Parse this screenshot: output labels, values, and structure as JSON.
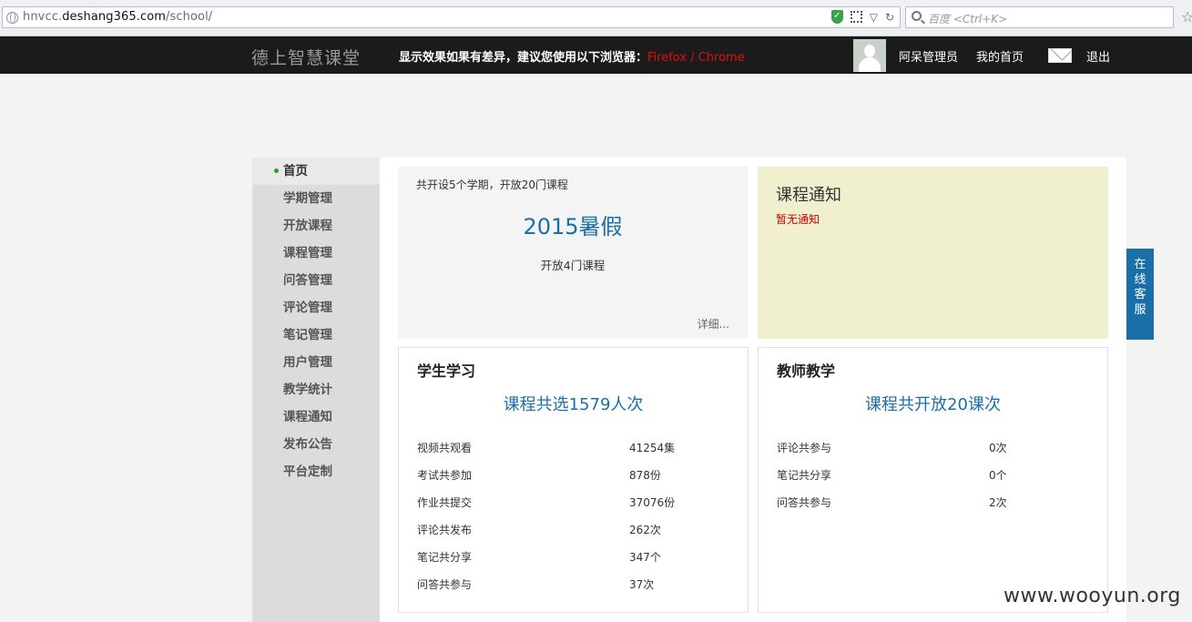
{
  "browser": {
    "url_prefix": "hnvcc.",
    "url_domain": "deshang365.com",
    "url_path": "/school/",
    "search_placeholder": "百度 <Ctrl+K>"
  },
  "header": {
    "logo": "德上智慧课堂",
    "notice_text": "显示效果如果有差异，建议您使用以下浏览器：",
    "browser_firefox": "Firefox",
    "browser_sep": " / ",
    "browser_chrome": "Chrome",
    "username": "阿呆管理员",
    "home_link": "我的首页",
    "logout": "退出"
  },
  "sidebar": {
    "items": [
      {
        "label": "首页",
        "active": true
      },
      {
        "label": "学期管理"
      },
      {
        "label": "开放课程"
      },
      {
        "label": "课程管理"
      },
      {
        "label": "问答管理"
      },
      {
        "label": "评论管理"
      },
      {
        "label": "笔记管理"
      },
      {
        "label": "用户管理"
      },
      {
        "label": "教学统计"
      },
      {
        "label": "课程通知"
      },
      {
        "label": "发布公告"
      },
      {
        "label": "平台定制"
      }
    ]
  },
  "semester": {
    "summary": "共开设5个学期，开放20门课程",
    "title": "2015暑假",
    "courses": "开放4门课程",
    "detail_link": "详细..."
  },
  "course_notice": {
    "title": "课程通知",
    "empty": "暂无通知"
  },
  "student": {
    "title": "学生学习",
    "headline": "课程共选1579人次",
    "stats": [
      {
        "label": "视频共观看",
        "value": "41254集"
      },
      {
        "label": "考试共参加",
        "value": "878份"
      },
      {
        "label": "作业共提交",
        "value": "37076份"
      },
      {
        "label": "评论共发布",
        "value": "262次"
      },
      {
        "label": "笔记共分享",
        "value": "347个"
      },
      {
        "label": "问答共参与",
        "value": "37次"
      }
    ]
  },
  "teacher": {
    "title": "教师教学",
    "headline": "课程共开放20课次",
    "stats": [
      {
        "label": "评论共参与",
        "value": "0次"
      },
      {
        "label": "笔记共分享",
        "value": "0个"
      },
      {
        "label": "问答共参与",
        "value": "2次"
      }
    ]
  },
  "service_tab": [
    "在",
    "线",
    "客",
    "服"
  ],
  "watermark": "www.wooyun.org"
}
